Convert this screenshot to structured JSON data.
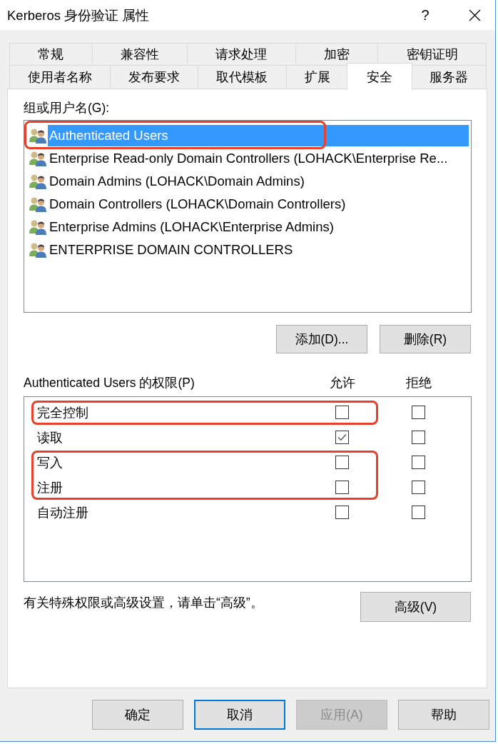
{
  "window": {
    "title": "Kerberos 身份验证 属性",
    "help_button": "?"
  },
  "tabs": [
    [
      {
        "label": "常规",
        "selected": false
      },
      {
        "label": "兼容性",
        "selected": false
      },
      {
        "label": "请求处理",
        "selected": false
      },
      {
        "label": "加密",
        "selected": false
      },
      {
        "label": "密钥证明",
        "selected": false
      }
    ],
    [
      {
        "label": "使用者名称",
        "selected": false
      },
      {
        "label": "发布要求",
        "selected": false
      },
      {
        "label": "取代模板",
        "selected": false
      },
      {
        "label": "扩展",
        "selected": false
      },
      {
        "label": "安全",
        "selected": true
      },
      {
        "label": "服务器",
        "selected": false
      }
    ]
  ],
  "groups": {
    "label": "组或用户名(G):",
    "items": [
      {
        "name": "Authenticated Users",
        "selected": true,
        "highlighted": true
      },
      {
        "name": "Enterprise Read-only Domain Controllers (LOHACK\\Enterprise Re...",
        "selected": false,
        "highlighted": false
      },
      {
        "name": "Domain Admins (LOHACK\\Domain Admins)",
        "selected": false,
        "highlighted": false
      },
      {
        "name": "Domain Controllers (LOHACK\\Domain Controllers)",
        "selected": false,
        "highlighted": false
      },
      {
        "name": "Enterprise Admins (LOHACK\\Enterprise Admins)",
        "selected": false,
        "highlighted": false
      },
      {
        "name": "ENTERPRISE DOMAIN CONTROLLERS",
        "selected": false,
        "highlighted": false
      }
    ]
  },
  "group_buttons": [
    "添加(D)...",
    "删除(R)"
  ],
  "permissions": {
    "label": "Authenticated Users 的权限(P)",
    "allow_header": "允许",
    "deny_header": "拒绝",
    "rows": [
      {
        "name": "完全控制",
        "allow": false,
        "deny": false,
        "highlighted": true
      },
      {
        "name": "读取",
        "allow": true,
        "deny": false,
        "highlighted": false
      },
      {
        "name": "写入",
        "allow": false,
        "deny": false,
        "highlighted": true
      },
      {
        "name": "注册",
        "allow": false,
        "deny": false,
        "highlighted": true
      },
      {
        "name": "自动注册",
        "allow": false,
        "deny": false,
        "highlighted": false
      }
    ]
  },
  "advanced": {
    "text": "有关特殊权限或高级设置，请单击“高级”。",
    "button": "高级(V)"
  },
  "buttons": [
    {
      "label": "确定",
      "default": false,
      "disabled": false
    },
    {
      "label": "取消",
      "default": true,
      "disabled": false
    },
    {
      "label": "应用(A)",
      "default": false,
      "disabled": true
    },
    {
      "label": "帮助",
      "default": false,
      "disabled": false
    }
  ]
}
